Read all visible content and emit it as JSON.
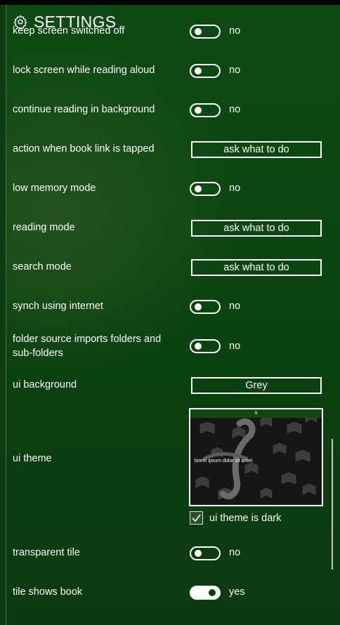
{
  "header": {
    "title": "SETTINGS",
    "icon": "gear-icon"
  },
  "settings": [
    {
      "label": "keep screen switched off",
      "control": "toggle",
      "value": "no"
    },
    {
      "label": "lock screen while reading aloud",
      "control": "toggle",
      "value": "no"
    },
    {
      "label": "continue reading in background",
      "control": "toggle",
      "value": "no"
    },
    {
      "label": "action when book link is tapped",
      "control": "dropdown",
      "value": "ask what to do"
    },
    {
      "label": "low memory mode",
      "control": "toggle",
      "value": "no"
    },
    {
      "label": "reading mode",
      "control": "dropdown",
      "value": "ask what to do"
    },
    {
      "label": "search mode",
      "control": "dropdown",
      "value": "ask what to do"
    },
    {
      "label": "synch using internet",
      "control": "toggle",
      "value": "no"
    },
    {
      "label": "folder source imports folders and sub-folders",
      "control": "toggle",
      "value": "no"
    },
    {
      "label": "ui background",
      "control": "dropdown",
      "value": "Grey"
    },
    {
      "label": "ui theme",
      "control": "theme-preview"
    },
    {
      "label": "transparent tile",
      "control": "toggle",
      "value": "no"
    },
    {
      "label": "tile shows book",
      "control": "toggle",
      "value": "yes"
    }
  ],
  "theme": {
    "preview_close": "x",
    "preview_text": "lorem ipsum dolor sit amet",
    "dark_checkbox_label": "ui theme is dark",
    "dark_checked": true
  },
  "colors": {
    "accent": "#0e4a12",
    "background": "#0b4511",
    "foreground": "#ffffff"
  }
}
